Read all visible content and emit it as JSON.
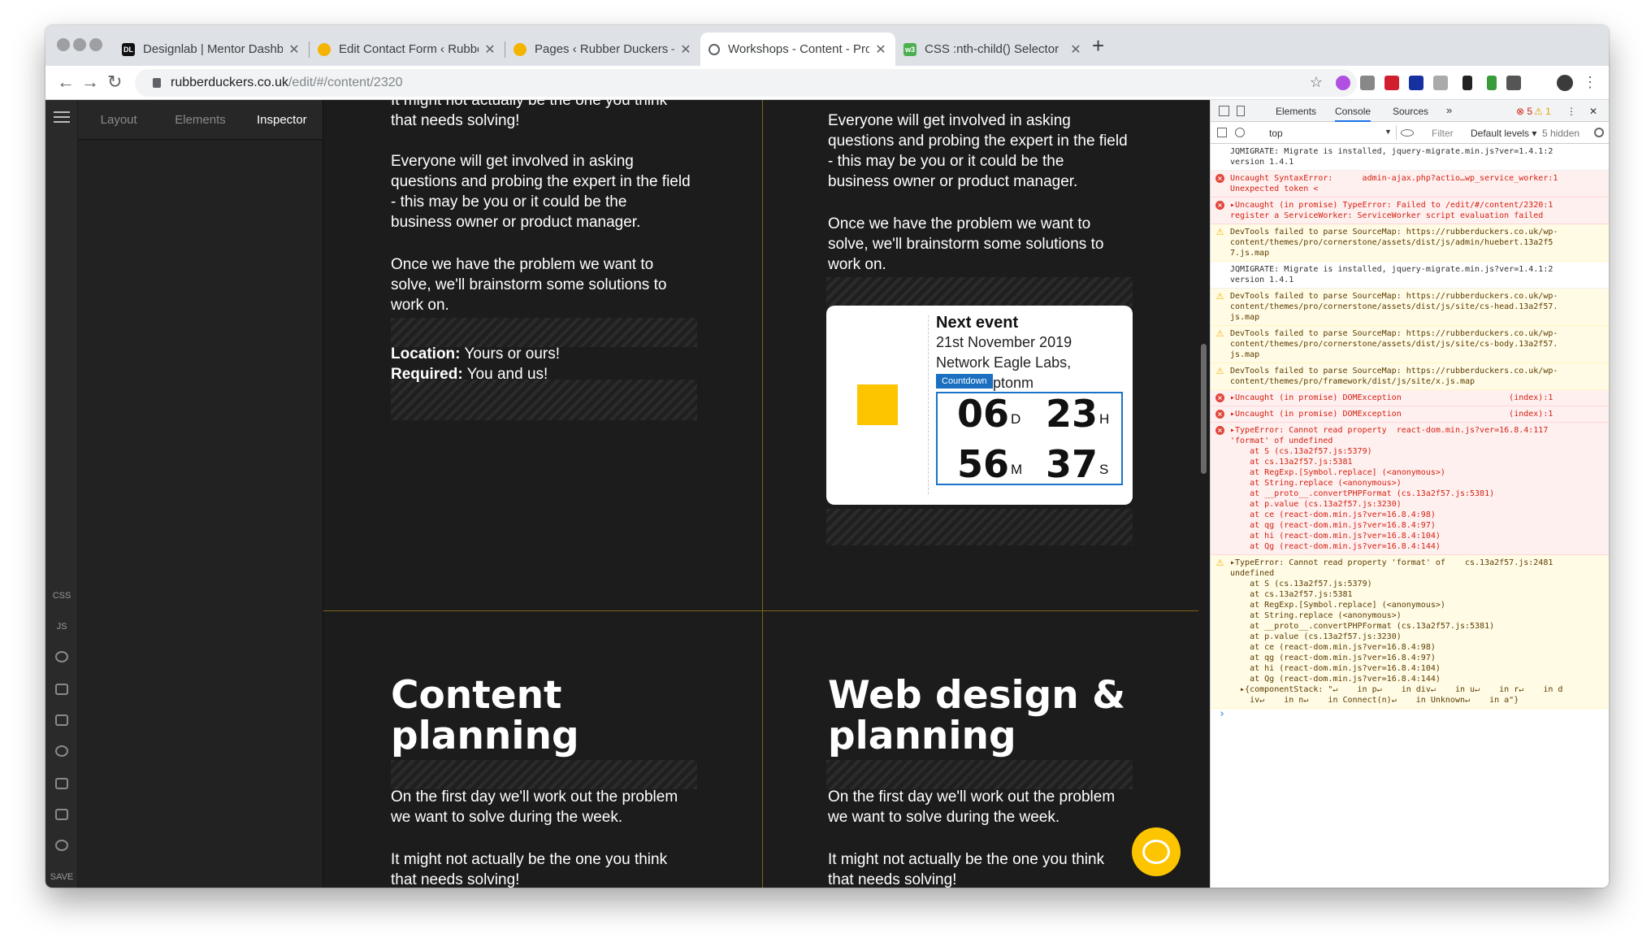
{
  "browser": {
    "tabs": [
      {
        "label": "Designlab | Mentor Dashboard",
        "icon": "designlab-favicon",
        "active": false
      },
      {
        "label": "Edit Contact Form ‹ Rubber Du",
        "icon": "duck-favicon",
        "active": false
      },
      {
        "label": "Pages ‹ Rubber Duckers — Wo",
        "icon": "duck-favicon",
        "active": false
      },
      {
        "label": "Workshops - Content - Pro",
        "icon": "globe-favicon",
        "active": true
      },
      {
        "label": "CSS :nth-child() Selector",
        "icon": "w3-favicon",
        "active": false
      }
    ],
    "favicon_text": {
      "designlab": "DL",
      "w3": "w3"
    },
    "url_domain": "rubberduckers.co.uk",
    "url_path": "/edit/#/content/2320"
  },
  "builder": {
    "inspector_tabs": [
      "Layout",
      "Elements",
      "Inspector"
    ],
    "active_tab": "Inspector",
    "left_labels": {
      "css": "CSS",
      "js": "JS",
      "save": "SAVE"
    }
  },
  "page": {
    "col1_top": {
      "partial": "It might not actually be the one you think",
      "line2": "that needs solving!",
      "para1": [
        "Everyone will get involved in asking",
        "questions and probing the expert in the field",
        "- this may be you or it could be the",
        "business owner or product manager."
      ],
      "para2": [
        "Once we have the problem we want to",
        "solve, we'll brainstorm some solutions to",
        "work on."
      ],
      "location_label": "Location:",
      "location_value": "Yours or ours!",
      "required_label": "Required:",
      "required_value": "You and us!"
    },
    "col2_top": {
      "para1": [
        "Everyone will get involved in asking",
        "questions and probing the expert in the field",
        "- this may be you or it could be the",
        "business owner or product manager."
      ],
      "para2": [
        "Once we have the problem we want to",
        "solve, we'll brainstorm some solutions to",
        "work on."
      ]
    },
    "event_card": {
      "title": "Next event",
      "date": "21st November 2019",
      "venue": "Network Eagle Labs,",
      "venue2": "nptonm",
      "countdown_tag": "Countdown",
      "days": "06",
      "days_unit": "D",
      "hours": "23",
      "hours_unit": "H",
      "minutes": "56",
      "minutes_unit": "M",
      "seconds": "37",
      "seconds_unit": "S"
    },
    "col1_bottom": {
      "heading": [
        "Content",
        "planning"
      ],
      "para1": [
        "On the first day we'll work out the problem",
        "we want to solve during the week."
      ],
      "para2": [
        "It might not actually be the one you think",
        "that needs solving!"
      ]
    },
    "col2_bottom": {
      "heading": [
        "Web design &",
        "planning"
      ],
      "para1": [
        "On the first day we'll work out the problem",
        "we want to solve during the week."
      ],
      "para2": [
        "It might not actually be the one you think",
        "that needs solving!"
      ]
    }
  },
  "devtools": {
    "tabs": [
      "Elements",
      "Console",
      "Sources"
    ],
    "active_tab": "Console",
    "more": "»",
    "errors": "5",
    "warnings": "1",
    "context": "top",
    "filter_placeholder": "Filter",
    "levels": "Default levels ▾",
    "hidden": "5 hidden",
    "logs": [
      {
        "type": "info",
        "text": "JQMIGRATE: Migrate is installed, jquery-migrate.min.js?ver=1.4.1:2\nversion 1.4.1"
      },
      {
        "type": "err",
        "text": "Uncaught SyntaxError:      admin-ajax.php?actio…wp_service_worker:1\nUnexpected token <"
      },
      {
        "type": "err",
        "text": "▸Uncaught (in promise) TypeError: Failed to /edit/#/content/2320:1\nregister a ServiceWorker: ServiceWorker script evaluation failed"
      },
      {
        "type": "warn",
        "text": "DevTools failed to parse SourceMap: https://rubberduckers.co.uk/wp-\ncontent/themes/pro/cornerstone/assets/dist/js/admin/huebert.13a2f5\n7.js.map"
      },
      {
        "type": "info",
        "text": "JQMIGRATE: Migrate is installed, jquery-migrate.min.js?ver=1.4.1:2\nversion 1.4.1"
      },
      {
        "type": "warn",
        "text": "DevTools failed to parse SourceMap: https://rubberduckers.co.uk/wp-\ncontent/themes/pro/cornerstone/assets/dist/js/site/cs-head.13a2f57.\njs.map"
      },
      {
        "type": "warn",
        "text": "DevTools failed to parse SourceMap: https://rubberduckers.co.uk/wp-\ncontent/themes/pro/cornerstone/assets/dist/js/site/cs-body.13a2f57.\njs.map"
      },
      {
        "type": "warn",
        "text": "DevTools failed to parse SourceMap: https://rubberduckers.co.uk/wp-\ncontent/themes/pro/framework/dist/js/site/x.js.map"
      },
      {
        "type": "err",
        "text": "▸Uncaught (in promise) DOMException                      (index):1"
      },
      {
        "type": "err",
        "text": "▸Uncaught (in promise) DOMException                      (index):1"
      },
      {
        "type": "err",
        "text": "▸TypeError: Cannot read property  react-dom.min.js?ver=16.8.4:117\n'format' of undefined\n    at S (cs.13a2f57.js:5379)\n    at cs.13a2f57.js:5381\n    at RegExp.[Symbol.replace] (<anonymous>)\n    at String.replace (<anonymous>)\n    at __proto__.convertPHPFormat (cs.13a2f57.js:5381)\n    at p.value (cs.13a2f57.js:3230)\n    at ce (react-dom.min.js?ver=16.8.4:98)\n    at qg (react-dom.min.js?ver=16.8.4:97)\n    at hi (react-dom.min.js?ver=16.8.4:104)\n    at Qg (react-dom.min.js?ver=16.8.4:144)"
      },
      {
        "type": "warn",
        "text": "▸TypeError: Cannot read property 'format' of    cs.13a2f57.js:2481\nundefined\n    at S (cs.13a2f57.js:5379)\n    at cs.13a2f57.js:5381\n    at RegExp.[Symbol.replace] (<anonymous>)\n    at String.replace (<anonymous>)\n    at __proto__.convertPHPFormat (cs.13a2f57.js:5381)\n    at p.value (cs.13a2f57.js:3230)\n    at ce (react-dom.min.js?ver=16.8.4:98)\n    at qg (react-dom.min.js?ver=16.8.4:97)\n    at hi (react-dom.min.js?ver=16.8.4:104)\n    at Qg (react-dom.min.js?ver=16.8.4:144)\n  ▸{componentStack: \"↵    in p↵    in div↵    in u↵    in r↵    in d\n    iv↵    in n↵    in Connect(n)↵    in Unknown↵    in a\"}"
      }
    ],
    "prompt": "›"
  },
  "colors": {
    "accent": "#fdc400",
    "page_bg": "#1c1c1c",
    "divider": "#7d6518",
    "countdown_blue": "#1a73c9"
  }
}
